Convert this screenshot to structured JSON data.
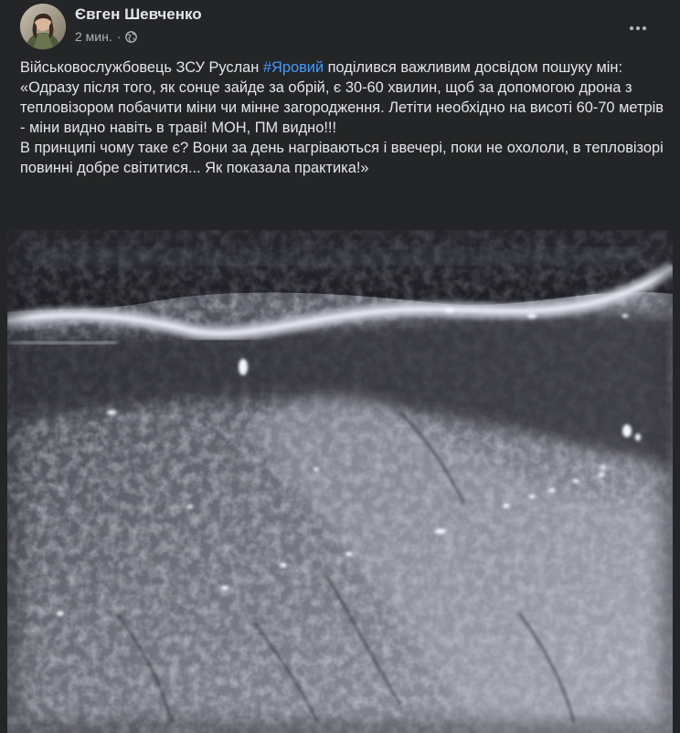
{
  "post": {
    "author": {
      "name": "Євген Шевченко",
      "avatar_icon": "user-avatar"
    },
    "meta": {
      "timestamp": "2 мин.",
      "separator": "·",
      "audience_icon": "globe-icon"
    },
    "more_icon": "more-horizontal-icon",
    "text": {
      "line1_before": "Військовослужбовець ЗСУ Руслан ",
      "hashtag": "#Яровий",
      "line1_after": " поділився важливим досвідом пошуку мін:",
      "quote": "«Одразу після того, як сонце зайде за обрій, є 30-60 хвилин, щоб за допомогою дрона з тепловізором побачити міни чи мінне загородження. Летіти необхідно на висоті 60-70 метрів - міни видно навіть в траві! МОН, ПМ видно!!!",
      "closing": "В принципі чому таке є? Вони за день нагріваються і ввечері, поки не охололи, в тепловізорі повинні добре світитися... Як показала практика!»"
    },
    "media": {
      "type": "thermal-drone-photo"
    },
    "colors": {
      "background": "#242526",
      "text": "#e4e6eb",
      "secondary_text": "#b0b3b8",
      "hashtag": "#4599ff"
    }
  }
}
